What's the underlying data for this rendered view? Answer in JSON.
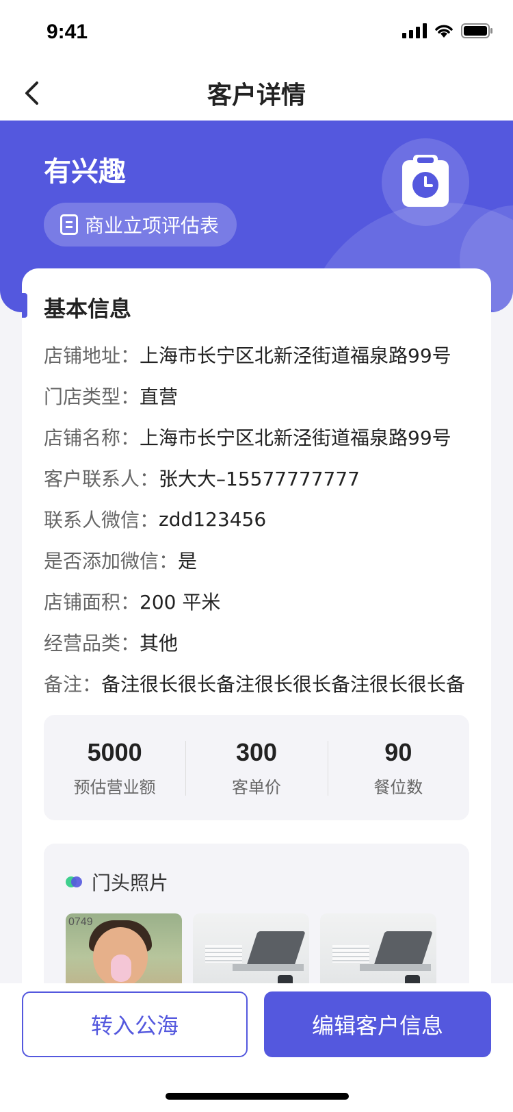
{
  "status_bar": {
    "time": "9:41"
  },
  "nav": {
    "title": "客户详情"
  },
  "hero": {
    "status": "有兴趣",
    "chip_label": "商业立项评估表"
  },
  "basic_info": {
    "title": "基本信息",
    "rows": [
      {
        "label": "店铺地址：",
        "value": "上海市长宁区北新泾街道福泉路99号"
      },
      {
        "label": "门店类型：",
        "value": "直营"
      },
      {
        "label": "店铺名称：",
        "value": "上海市长宁区北新泾街道福泉路99号"
      },
      {
        "label": "客户联系人：",
        "value": "张大大–15577777777"
      },
      {
        "label": "联系人微信：",
        "value": "zdd123456"
      },
      {
        "label": "是否添加微信：",
        "value": "是"
      },
      {
        "label": "店铺面积：",
        "value": "200 平米"
      },
      {
        "label": "经营品类：",
        "value": "其他"
      },
      {
        "label": "备注：",
        "value": "备注很长很长备注很长很长备注很长很长备"
      }
    ]
  },
  "stats": [
    {
      "value": "5000",
      "label": "预估营业额"
    },
    {
      "value": "300",
      "label": "客单价"
    },
    {
      "value": "90",
      "label": "餐位数"
    }
  ],
  "photos": {
    "title": "门头照片",
    "kid_sign_text": "0749"
  },
  "actions": {
    "secondary": "转入公海",
    "primary": "编辑客户信息"
  },
  "colors": {
    "accent": "#5458de",
    "background": "#f4f4f8",
    "green_dot": "#3ecf8e"
  }
}
